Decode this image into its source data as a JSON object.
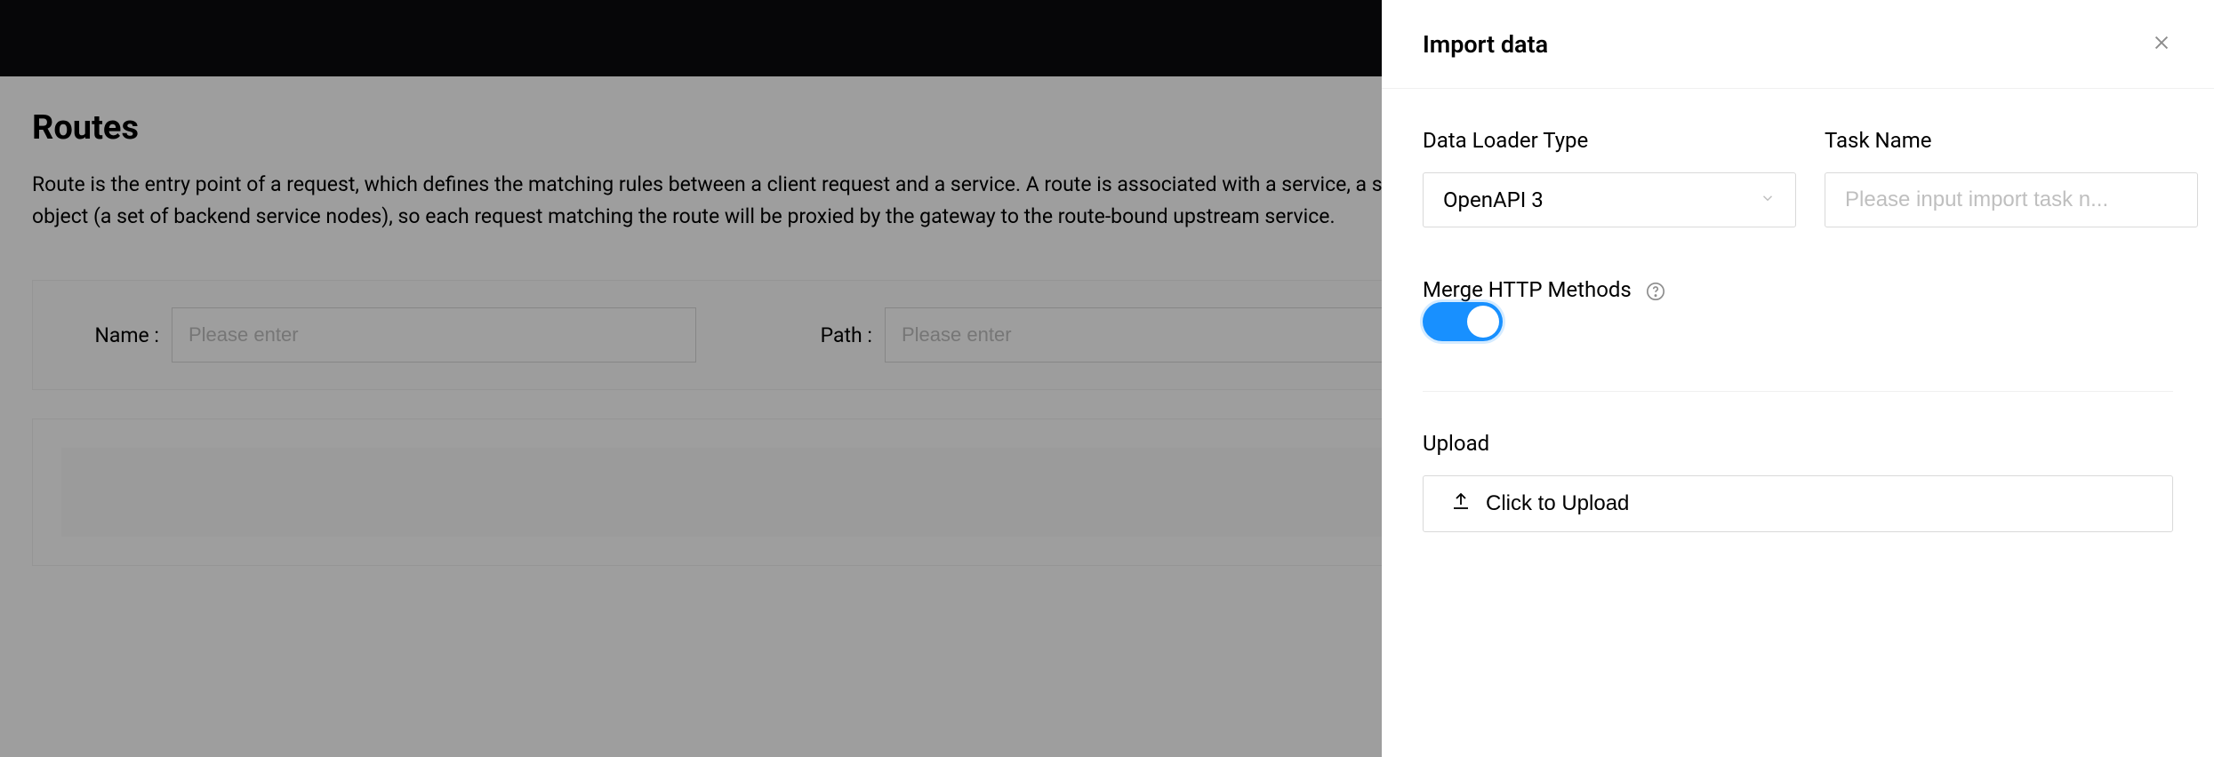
{
  "page": {
    "title": "Routes",
    "description": "Route is the entry point of a request, which defines the matching rules between a client request and a service. A route is associated with a service, a service can correspond to a set of routes, and a route can correspond to an upstream object (a set of backend service nodes), so each request matching the route will be proxied by the gateway to the route-bound upstream service."
  },
  "filters": {
    "name_label": "Name :",
    "name_placeholder": "Please enter",
    "path_label": "Path :",
    "path_placeholder": "Please enter"
  },
  "drawer": {
    "title": "Import data",
    "data_loader_label": "Data Loader Type",
    "data_loader_value": "OpenAPI 3",
    "task_name_label": "Task Name",
    "task_name_placeholder": "Please input import task n...",
    "merge_label": "Merge HTTP Methods",
    "merge_enabled": true,
    "upload_label": "Upload",
    "upload_button": "Click to Upload"
  }
}
